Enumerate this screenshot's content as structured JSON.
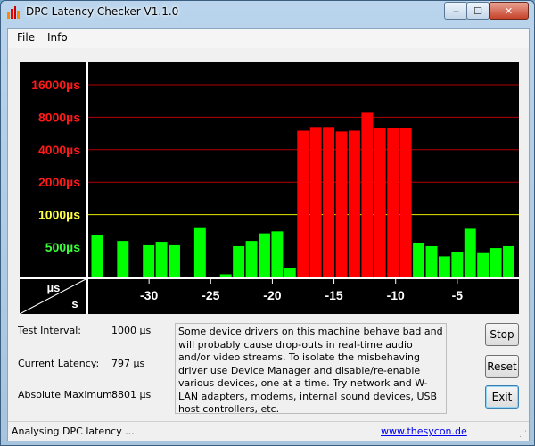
{
  "window": {
    "title": "DPC Latency Checker V1.1.0"
  },
  "titlebar_controls": {
    "minimize": "‒",
    "maximize": "☐",
    "close": "✕"
  },
  "menu": [
    {
      "label": "File"
    },
    {
      "label": "Info"
    }
  ],
  "chart_data": {
    "type": "bar",
    "y_scale": "log",
    "x_unit_label": "s",
    "y_unit_label": "µs",
    "x_ticks": [
      {
        "label": "-30",
        "value": -30
      },
      {
        "label": "-25",
        "value": -25
      },
      {
        "label": "-20",
        "value": -20
      },
      {
        "label": "-15",
        "value": -15
      },
      {
        "label": "-10",
        "value": -10
      },
      {
        "label": "-5",
        "value": -5
      }
    ],
    "y_ticks": [
      {
        "label": "16000µs",
        "value": 16000,
        "color": "#ff1a1a"
      },
      {
        "label": "8000µs",
        "value": 8000,
        "color": "#ff1a1a"
      },
      {
        "label": "4000µs",
        "value": 4000,
        "color": "#ff1a1a"
      },
      {
        "label": "2000µs",
        "value": 2000,
        "color": "#ff1a1a"
      },
      {
        "label": "1000µs",
        "value": 1000,
        "color": "#ffff44"
      },
      {
        "label": "500µs",
        "value": 500,
        "color": "#3cff3c"
      }
    ],
    "x_range": [
      -35,
      0
    ],
    "values": [
      650,
      180,
      570,
      180,
      520,
      560,
      520,
      250,
      750,
      210,
      280,
      510,
      570,
      670,
      700,
      320,
      6000,
      6500,
      6500,
      5900,
      6000,
      8800,
      6400,
      6400,
      6300,
      550,
      510,
      410,
      450,
      740,
      440,
      490,
      510
    ],
    "threshold": 1000,
    "colors": {
      "ok": "#00ff00",
      "bad": "#ff0000",
      "threshold_line": "#e8e800",
      "gridline": "#b00000",
      "axis": "#ffffff",
      "background": "#000000"
    }
  },
  "stats": [
    {
      "label": "Test Interval:",
      "value": "1000 µs"
    },
    {
      "label": "Current Latency:",
      "value": "797 µs"
    },
    {
      "label": "Absolute Maximum:",
      "value": "8801 µs"
    }
  ],
  "info_text": "Some device drivers on this machine behave bad and will probably cause drop-outs in real-time audio and/or video streams. To isolate the misbehaving driver use Device Manager and disable/re-enable various devices, one at a time. Try network and W-LAN adapters, modems, internal sound devices, USB host controllers, etc.",
  "buttons": {
    "stop": "Stop",
    "reset": "Reset",
    "exit": "Exit"
  },
  "status": {
    "text": "Analysing DPC latency ...",
    "link": "www.thesycon.de"
  }
}
